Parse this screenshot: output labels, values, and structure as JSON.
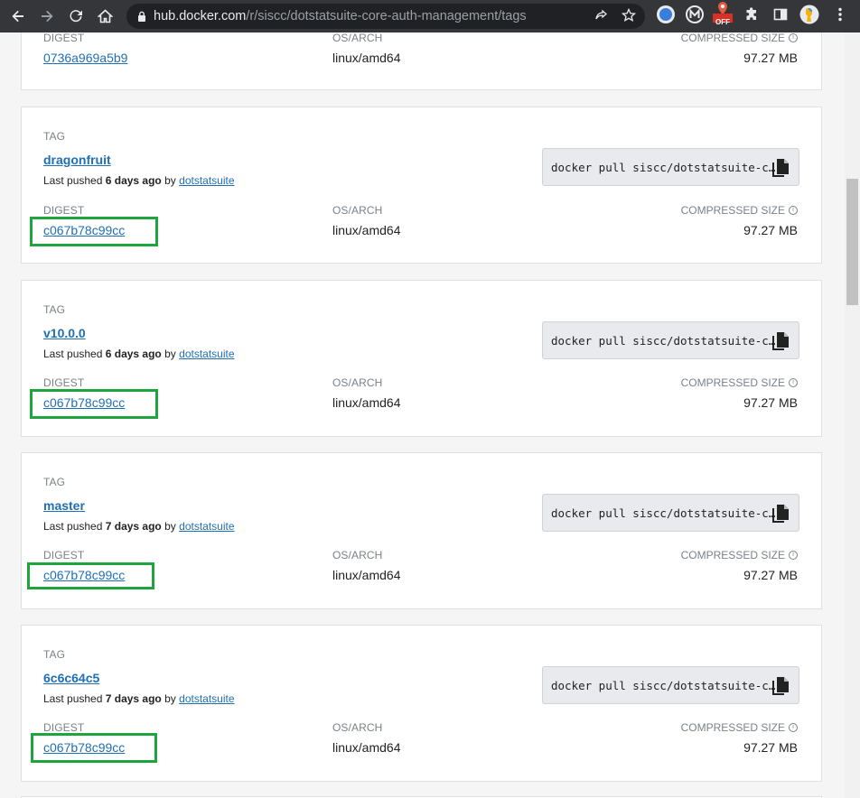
{
  "browser": {
    "url_host": "hub.docker.com",
    "url_path": "/r/siscc/dotstatsuite-core-auth-management/tags",
    "extension_badge": "OFF"
  },
  "labels": {
    "tag": "TAG",
    "digest": "DIGEST",
    "os_arch": "OS/ARCH",
    "compressed_size": "COMPRESSED SIZE",
    "last_pushed": "Last pushed",
    "by": "by"
  },
  "top_partial": {
    "digest": "0736a969a5b9",
    "os_arch": "linux/amd64",
    "size": "97.27 MB"
  },
  "tags": [
    {
      "name": "dragonfruit",
      "pushed_ago": "6 days ago",
      "pushed_by": "dotstatsuite",
      "pull_command": "docker pull siscc/dotstatsuite-c…",
      "digest": "c067b78c99cc",
      "os_arch": "linux/amd64",
      "size": "97.27 MB"
    },
    {
      "name": "v10.0.0",
      "pushed_ago": "6 days ago",
      "pushed_by": "dotstatsuite",
      "pull_command": "docker pull siscc/dotstatsuite-c…",
      "digest": "c067b78c99cc",
      "os_arch": "linux/amd64",
      "size": "97.27 MB"
    },
    {
      "name": "master",
      "pushed_ago": "7 days ago",
      "pushed_by": "dotstatsuite",
      "pull_command": "docker pull siscc/dotstatsuite-c…",
      "digest": "c067b78c99cc",
      "os_arch": "linux/amd64",
      "size": "97.27 MB"
    },
    {
      "name": "6c6c64c5",
      "pushed_ago": "7 days ago",
      "pushed_by": "dotstatsuite",
      "pull_command": "docker pull siscc/dotstatsuite-c…",
      "digest": "c067b78c99cc",
      "os_arch": "linux/amd64",
      "size": "97.27 MB"
    }
  ],
  "colors": {
    "link": "#1f6fb5",
    "highlight": "#1fa53d",
    "chrome": "#35363a"
  }
}
